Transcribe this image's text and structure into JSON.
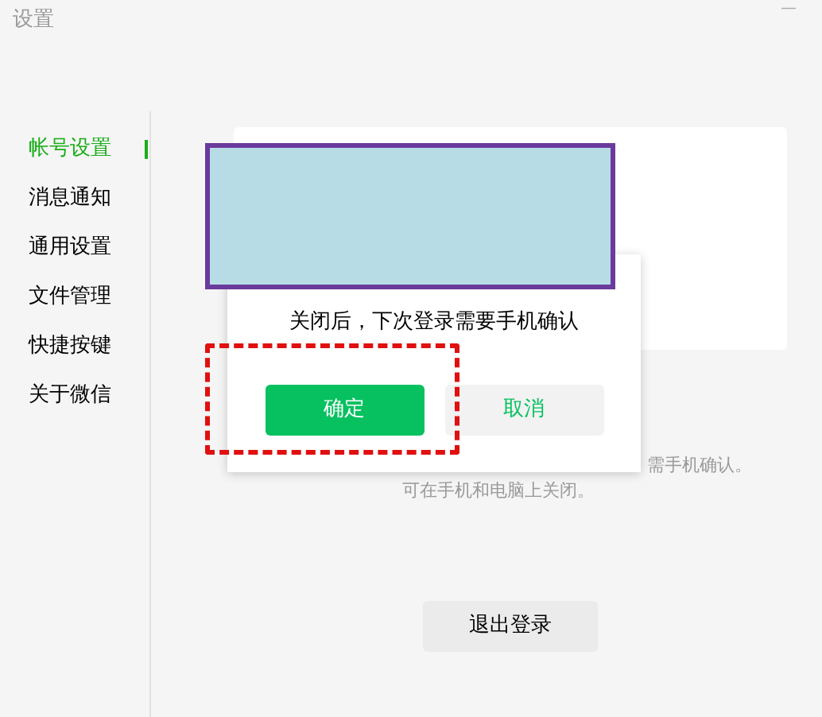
{
  "window": {
    "title": "设置",
    "minimize": "—"
  },
  "sidebar": {
    "items": [
      {
        "label": "帐号设置",
        "selected": true
      },
      {
        "label": "消息通知",
        "selected": false
      },
      {
        "label": "通用设置",
        "selected": false
      },
      {
        "label": "文件管理",
        "selected": false
      },
      {
        "label": "快捷按键",
        "selected": false
      },
      {
        "label": "关于微信",
        "selected": false
      }
    ]
  },
  "hint": {
    "lines": [
      "需手机确认。",
      "可在手机和电脑上关闭。"
    ]
  },
  "logout_button": "退出登录",
  "dialog": {
    "message": "关闭后，下次登录需要手机确认",
    "buttons": [
      {
        "label": "确定",
        "kind": "primary"
      },
      {
        "label": "取消",
        "kind": "secondary"
      }
    ]
  }
}
